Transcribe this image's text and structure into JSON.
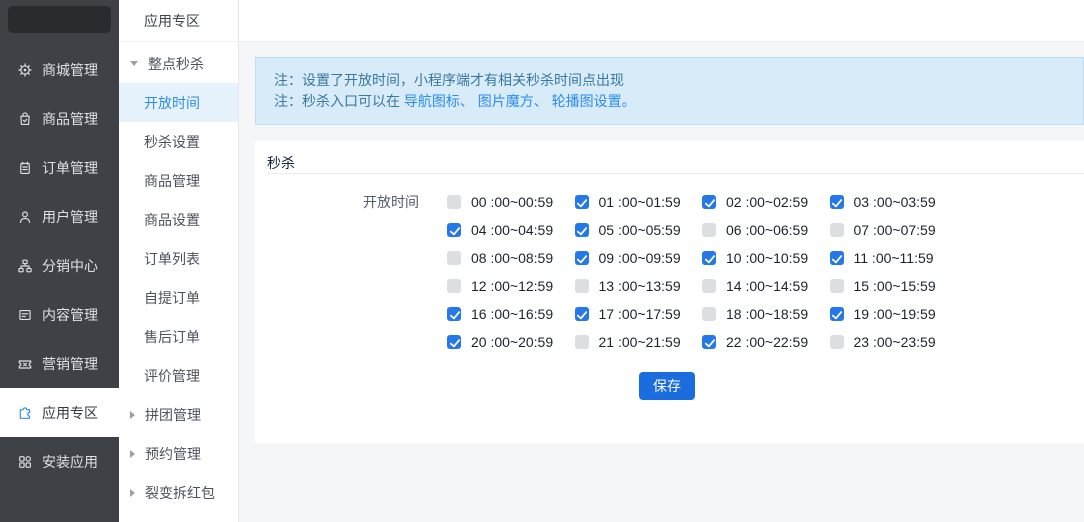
{
  "colors": {
    "accent": "#2d8cf0",
    "sidebar_bg": "#3e4246",
    "sidebar_logo": "#292c2f",
    "sidebar_text": "#dfe2e5",
    "submenu_active_bg": "#e7f3fc",
    "main_bg": "#f5f6f8",
    "notice_bg": "#d7ecf8",
    "notice_border": "#bddef2",
    "notice_text": "#39789f",
    "notice_link": "#2d8cf0",
    "checkbox_on": "#2478e8",
    "checkbox_off": "#dcdee2",
    "button_bg": "#1a6cdf",
    "button_text": "#ffffff"
  },
  "sidebar": {
    "items": [
      {
        "label": "商城管理",
        "icon": "cog-icon",
        "active": false
      },
      {
        "label": "商品管理",
        "icon": "bag-icon",
        "active": false
      },
      {
        "label": "订单管理",
        "icon": "clipboard-icon",
        "active": false
      },
      {
        "label": "用户管理",
        "icon": "user-icon",
        "active": false
      },
      {
        "label": "分销中心",
        "icon": "network-icon",
        "active": false
      },
      {
        "label": "内容管理",
        "icon": "content-icon",
        "active": false
      },
      {
        "label": "营销管理",
        "icon": "ticket-icon",
        "active": false
      },
      {
        "label": "应用专区",
        "icon": "puzzle-icon",
        "active": true
      },
      {
        "label": "安装应用",
        "icon": "apps-icon",
        "active": false
      }
    ]
  },
  "submenu": {
    "title": "应用专区",
    "items": [
      {
        "type": "group",
        "label": "整点秒杀",
        "expanded": true
      },
      {
        "type": "child",
        "label": "开放时间",
        "active": true
      },
      {
        "type": "child",
        "label": "秒杀设置",
        "active": false
      },
      {
        "type": "child",
        "label": "商品管理",
        "active": false
      },
      {
        "type": "child",
        "label": "商品设置",
        "active": false
      },
      {
        "type": "child",
        "label": "订单列表",
        "active": false
      },
      {
        "type": "child",
        "label": "自提订单",
        "active": false
      },
      {
        "type": "child",
        "label": "售后订单",
        "active": false
      },
      {
        "type": "child",
        "label": "评价管理",
        "active": false
      },
      {
        "type": "group",
        "label": "拼团管理",
        "expanded": false
      },
      {
        "type": "group",
        "label": "预约管理",
        "expanded": false
      },
      {
        "type": "group",
        "label": "裂变拆红包",
        "expanded": false
      }
    ]
  },
  "notice": {
    "line1": "注：设置了开放时间，小程序端才有相关秒杀时间点出现",
    "line2_prefix": "注：秒杀入口可以在 ",
    "line2_links": "导航图标、 图片魔方、 轮播图设置。"
  },
  "panel": {
    "title": "秒杀",
    "field_label": "开放时间",
    "save_label": "保存",
    "time_slots": [
      {
        "label": "00 :00~00:59",
        "checked": false
      },
      {
        "label": "01 :00~01:59",
        "checked": true
      },
      {
        "label": "02 :00~02:59",
        "checked": true
      },
      {
        "label": "03 :00~03:59",
        "checked": true
      },
      {
        "label": "04 :00~04:59",
        "checked": true
      },
      {
        "label": "05 :00~05:59",
        "checked": true
      },
      {
        "label": "06 :00~06:59",
        "checked": false
      },
      {
        "label": "07 :00~07:59",
        "checked": false
      },
      {
        "label": "08 :00~08:59",
        "checked": false
      },
      {
        "label": "09 :00~09:59",
        "checked": true
      },
      {
        "label": "10 :00~10:59",
        "checked": true
      },
      {
        "label": "11 :00~11:59",
        "checked": true
      },
      {
        "label": "12 :00~12:59",
        "checked": false
      },
      {
        "label": "13 :00~13:59",
        "checked": false
      },
      {
        "label": "14 :00~14:59",
        "checked": false
      },
      {
        "label": "15 :00~15:59",
        "checked": false
      },
      {
        "label": "16 :00~16:59",
        "checked": true
      },
      {
        "label": "17 :00~17:59",
        "checked": true
      },
      {
        "label": "18 :00~18:59",
        "checked": false
      },
      {
        "label": "19 :00~19:59",
        "checked": true
      },
      {
        "label": "20 :00~20:59",
        "checked": true
      },
      {
        "label": "21 :00~21:59",
        "checked": false
      },
      {
        "label": "22 :00~22:59",
        "checked": true
      },
      {
        "label": "23 :00~23:59",
        "checked": false
      }
    ]
  }
}
